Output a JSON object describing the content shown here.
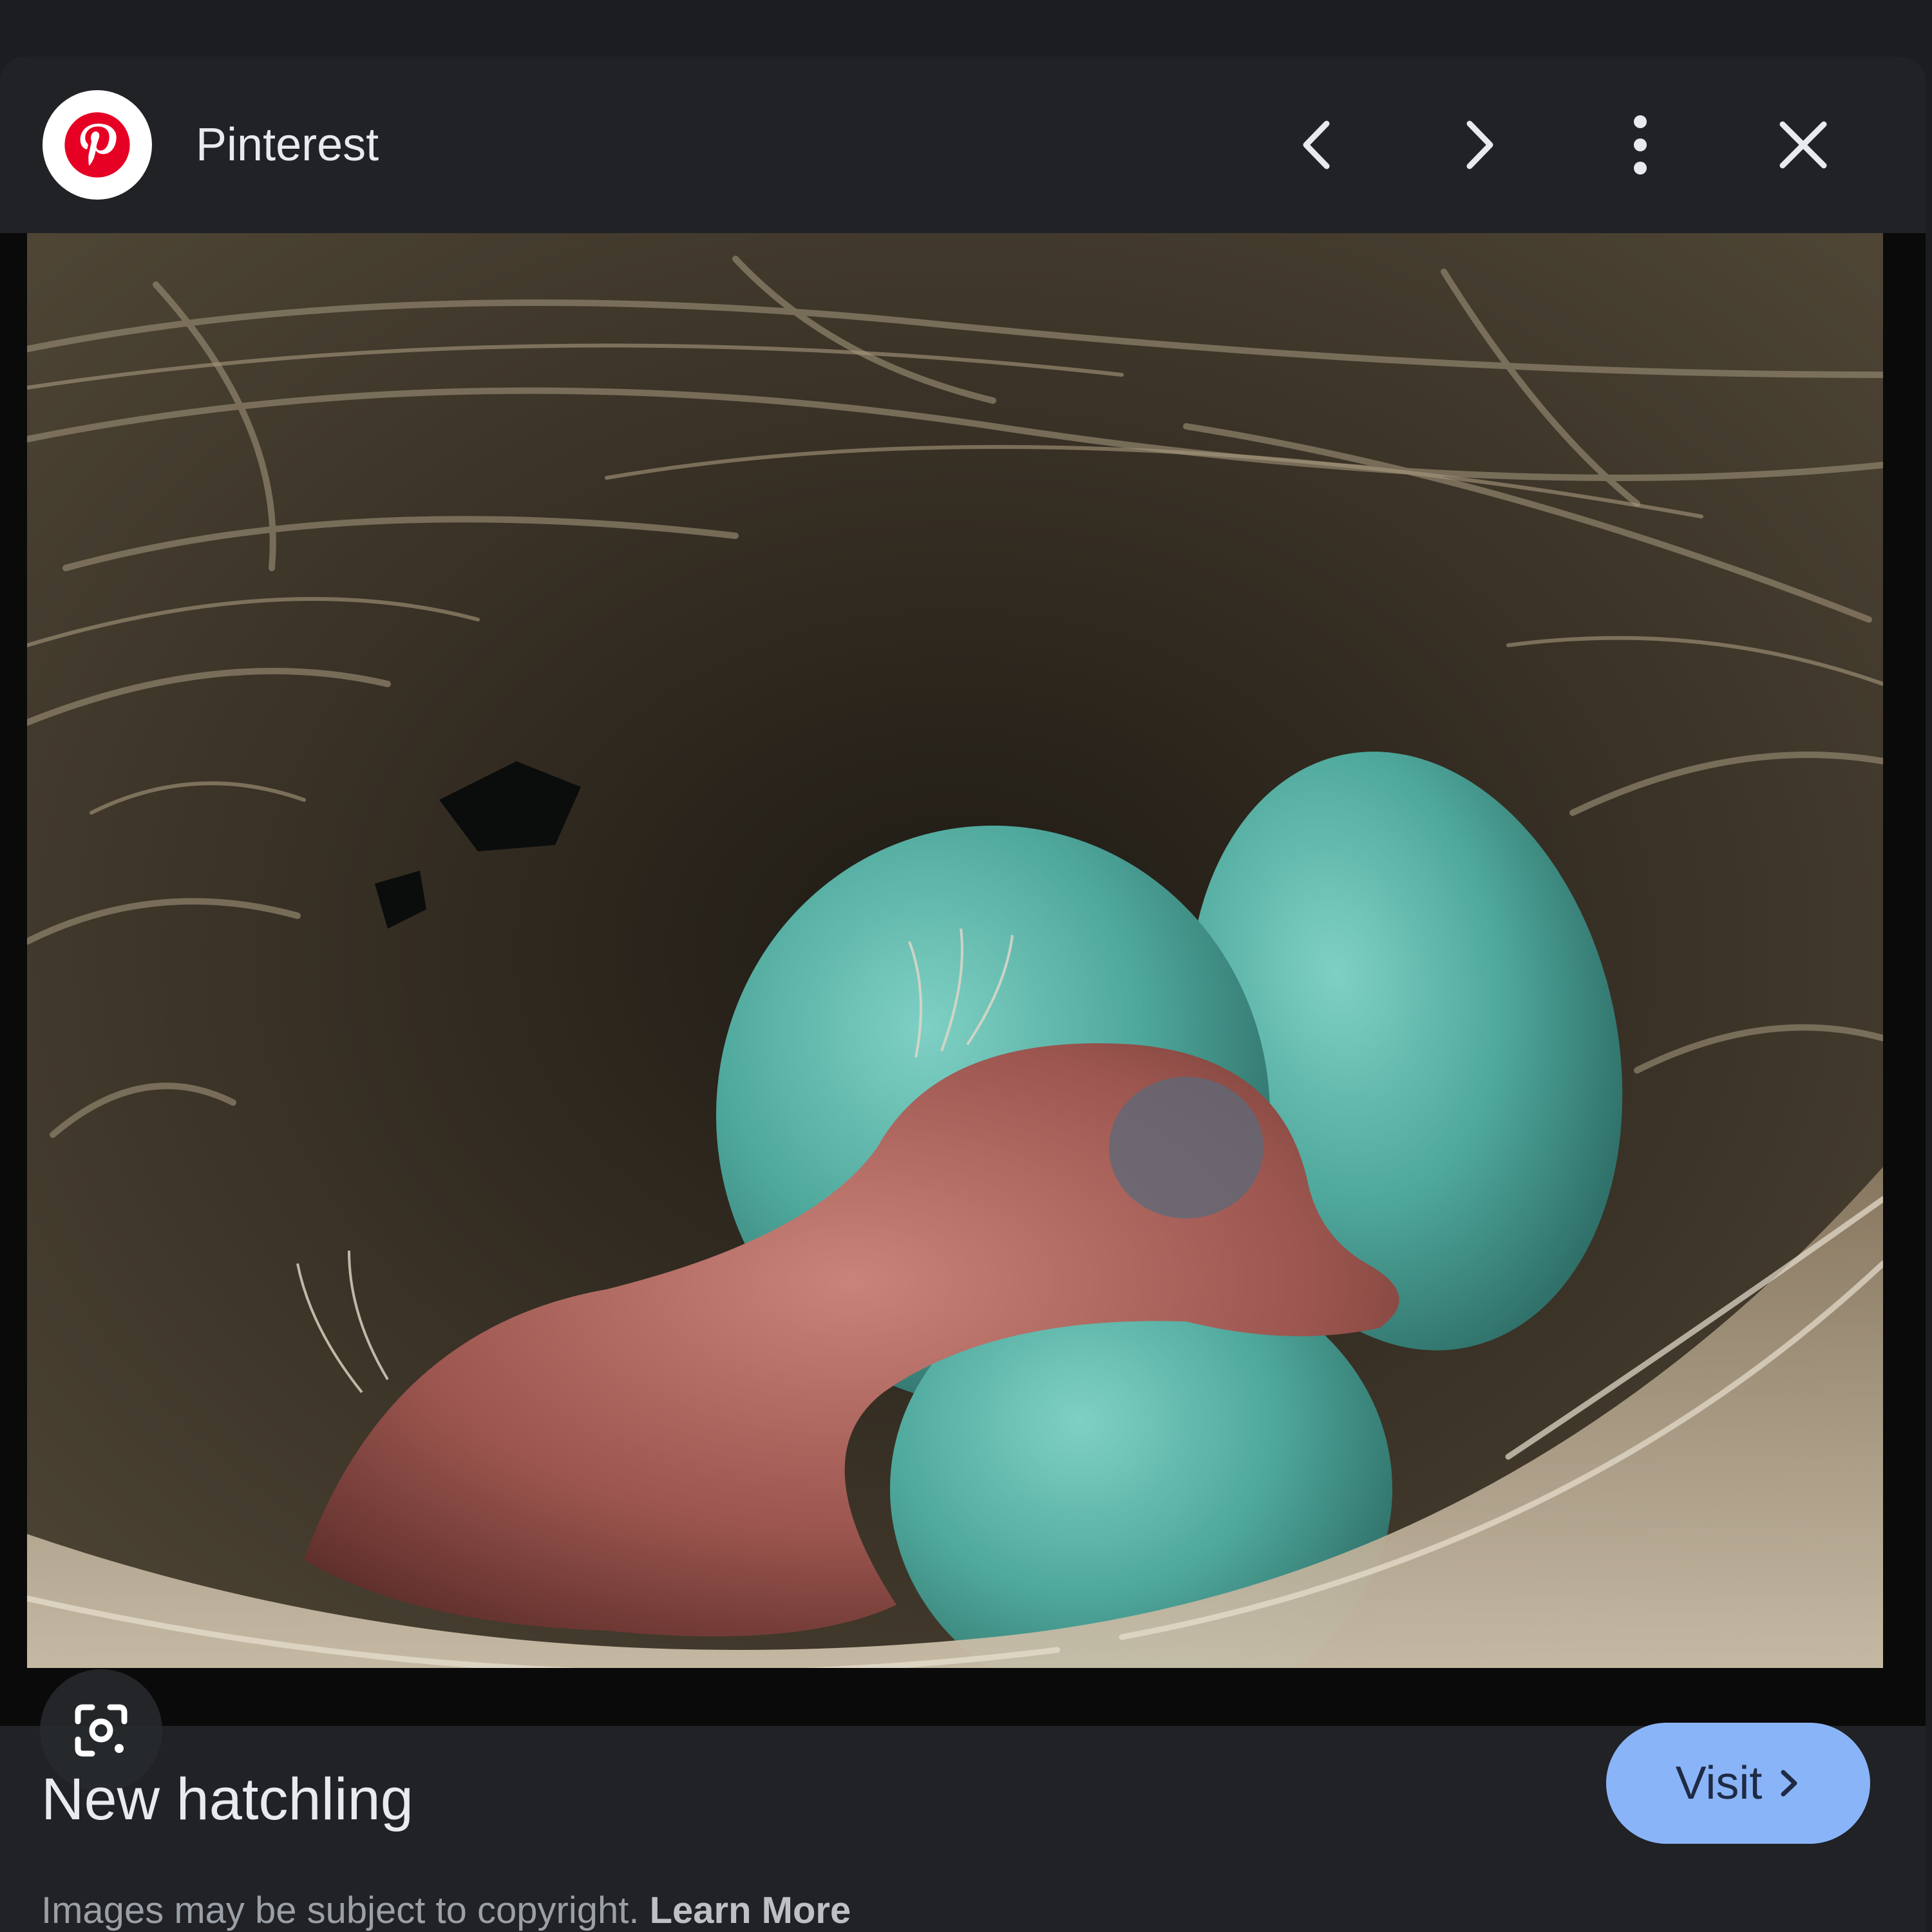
{
  "header": {
    "source_name": "Pinterest",
    "source_icon": "pinterest-logo-icon",
    "brand_color": "#e60023",
    "buttons": {
      "prev_icon": "chevron-left-icon",
      "next_icon": "chevron-right-icon",
      "more_icon": "more-vert-icon",
      "close_icon": "close-icon"
    }
  },
  "image": {
    "subject": "newly hatched bird in nest with three blue eggs",
    "lens_icon": "google-lens-icon"
  },
  "caption": {
    "title": "New hatchling",
    "visit_label": "Visit",
    "visit_icon": "chevron-right-icon",
    "accent_color": "#8ab4f8"
  },
  "footer": {
    "copyright_text": "Images may be subject to copyright.",
    "learn_more_label": "Learn More"
  }
}
